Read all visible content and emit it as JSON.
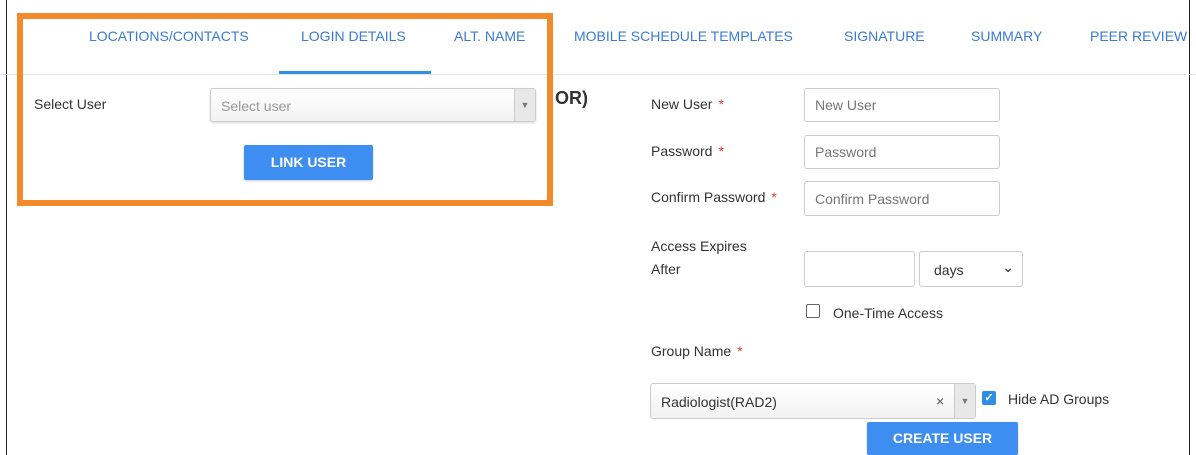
{
  "tabs": [
    {
      "label": "LOCATIONS/CONTACTS"
    },
    {
      "label": "LOGIN DETAILS",
      "active": true
    },
    {
      "label": "ALT. NAME"
    },
    {
      "label": "MOBILE SCHEDULE TEMPLATES"
    },
    {
      "label": "SIGNATURE"
    },
    {
      "label": "SUMMARY"
    },
    {
      "label": "PEER REVIEW"
    }
  ],
  "link_user": {
    "select_label": "Select User",
    "select_placeholder": "Select user",
    "button_label": "LINK USER"
  },
  "or_text": "OR)",
  "create_user": {
    "new_user_label": "New User",
    "new_user_placeholder": "New User",
    "password_label": "Password",
    "password_placeholder": "Password",
    "confirm_label": "Confirm Password",
    "confirm_placeholder": "Confirm Password",
    "access_label_line1": "Access Expires",
    "access_label_line2": "After",
    "access_value": "",
    "access_unit": "days",
    "one_time_label": "One-Time Access",
    "one_time_checked": false,
    "group_label": "Group Name",
    "group_value": "Radiologist(RAD2)",
    "clear_symbol": "×",
    "hide_ad_label": "Hide AD Groups",
    "hide_ad_checked": true,
    "required_mark": "*",
    "button_label": "CREATE USER"
  },
  "colors": {
    "accent": "#3d8ef0",
    "tab_text": "#3a7bd5",
    "highlight": "#f28a2c",
    "required": "#e53935"
  }
}
